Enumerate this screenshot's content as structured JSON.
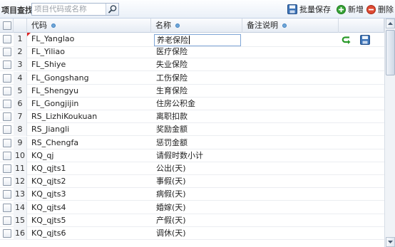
{
  "toolbar": {
    "label": "项目查找:",
    "search_placeholder": "项目代码或名称",
    "batch_save_label": "批量保存",
    "add_label": "新增",
    "delete_label": "删除"
  },
  "grid": {
    "columns": [
      "代码",
      "名称",
      "备注说明"
    ],
    "editing_value": "养老保险",
    "rows": [
      {
        "num": "1",
        "code": "FL_Yanglao",
        "name": "养老保险"
      },
      {
        "num": "2",
        "code": "FL_Yiliao",
        "name": "医疗保险"
      },
      {
        "num": "3",
        "code": "FL_Shiye",
        "name": "失业保险"
      },
      {
        "num": "4",
        "code": "FL_Gongshang",
        "name": "工伤保险"
      },
      {
        "num": "5",
        "code": "FL_Shengyu",
        "name": "生育保险"
      },
      {
        "num": "6",
        "code": "FL_Gongjijin",
        "name": "住房公积金"
      },
      {
        "num": "7",
        "code": "RS_LizhiKoukuan",
        "name": "离职扣款"
      },
      {
        "num": "8",
        "code": "RS_Jiangli",
        "name": "奖励金额"
      },
      {
        "num": "9",
        "code": "RS_Chengfa",
        "name": "惩罚金额"
      },
      {
        "num": "10",
        "code": "KQ_qj",
        "name": "请假时数小计"
      },
      {
        "num": "11",
        "code": "KQ_qjts1",
        "name": "公出(天)"
      },
      {
        "num": "12",
        "code": "KQ_qjts2",
        "name": "事假(天)"
      },
      {
        "num": "13",
        "code": "KQ_qjts3",
        "name": "病假(天)"
      },
      {
        "num": "14",
        "code": "KQ_qjts4",
        "name": "婚嫁(天)"
      },
      {
        "num": "15",
        "code": "KQ_qjts5",
        "name": "产假(天)"
      },
      {
        "num": "16",
        "code": "KQ_qjts6",
        "name": "调休(天)"
      }
    ]
  },
  "colors": {
    "accent": "#3f7fbf",
    "save_green": "#2a9a2a",
    "delete_red": "#d9412b"
  }
}
